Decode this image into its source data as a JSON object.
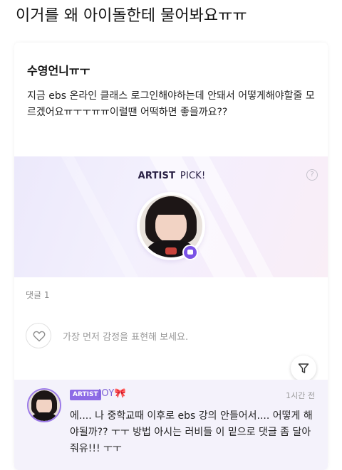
{
  "header": {
    "title": "이거를 왜 아이돌한테 물어봐요ㅠㅠ"
  },
  "post": {
    "author": "수영언니ㅠㅜ",
    "body": "지금 ebs 온라인 클래스 로그인해야하는데 안돼서 어떻게해야할줄 모르겠어요ㅠㅜㅜㅠㅠ이럴땐 어떡하면 좋을까요??"
  },
  "artist_pick": {
    "title_highlight": "ARTIST",
    "title_rest": "PICK!",
    "help_icon": "question-circle-icon",
    "badge_icon": "chat-bubble-icon",
    "accent_color": "#7b53e6"
  },
  "comments": {
    "count_label": "댓글 1"
  },
  "reaction": {
    "icon": "heart-outline-icon",
    "placeholder": "가장 먼저 감정을 표현해 보세요."
  },
  "filter": {
    "icon": "filter-icon"
  },
  "artist_comment": {
    "tag": "ARTIST",
    "name": "JOY🎀",
    "time": "1시간 전",
    "text": "에.... 나 중학교때 이후로 ebs 강의 안들어서.... 어떻게 해야될까?? ㅜㅜ 방법 아시는 러비들 이 밑으로 댓글 좀 달아줘유!!! ㅜㅜ"
  }
}
